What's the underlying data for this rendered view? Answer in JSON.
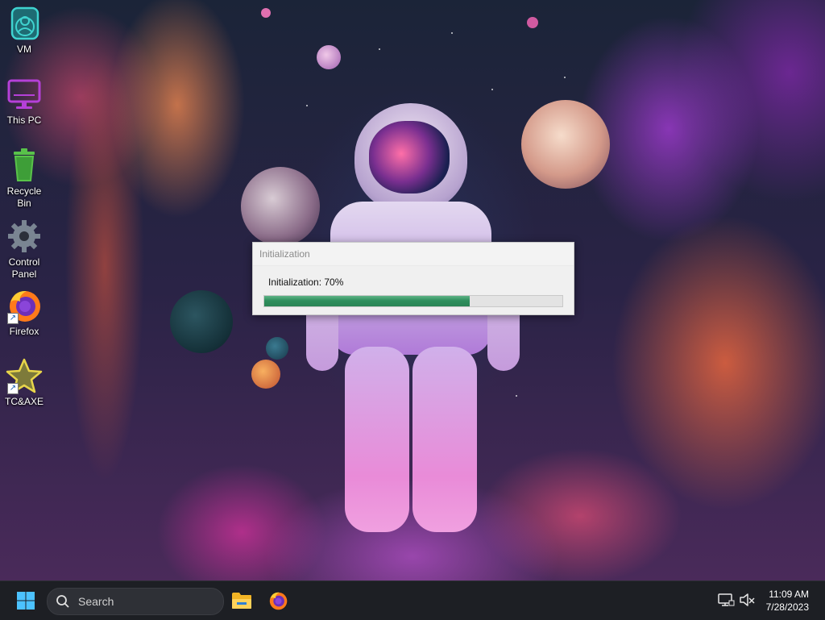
{
  "desktop": {
    "icons": [
      {
        "label": "VM",
        "icon": "vm-folder-icon"
      },
      {
        "label": "This PC",
        "icon": "monitor-icon"
      },
      {
        "label": "Recycle Bin",
        "icon": "recycle-bin-icon"
      },
      {
        "label": "Control Panel",
        "icon": "gear-icon"
      },
      {
        "label": "Firefox",
        "icon": "firefox-icon"
      },
      {
        "label": "TC&AXE",
        "icon": "star-icon"
      }
    ]
  },
  "dialog": {
    "title": "Initialization",
    "status": "Initialization: 70%",
    "progress": 0.69
  },
  "taskbar": {
    "search_label": "Search",
    "pinned": [
      "windows-start-icon",
      "file-explorer-icon",
      "firefox-icon"
    ],
    "tray": [
      "network-icon",
      "volume-muted-icon"
    ],
    "clock": {
      "time": "11:09 AM",
      "date": "7/28/2023"
    }
  },
  "colors": {
    "progress_fill": "#2f8f5d",
    "taskbar_bg": "#1d1f24"
  }
}
